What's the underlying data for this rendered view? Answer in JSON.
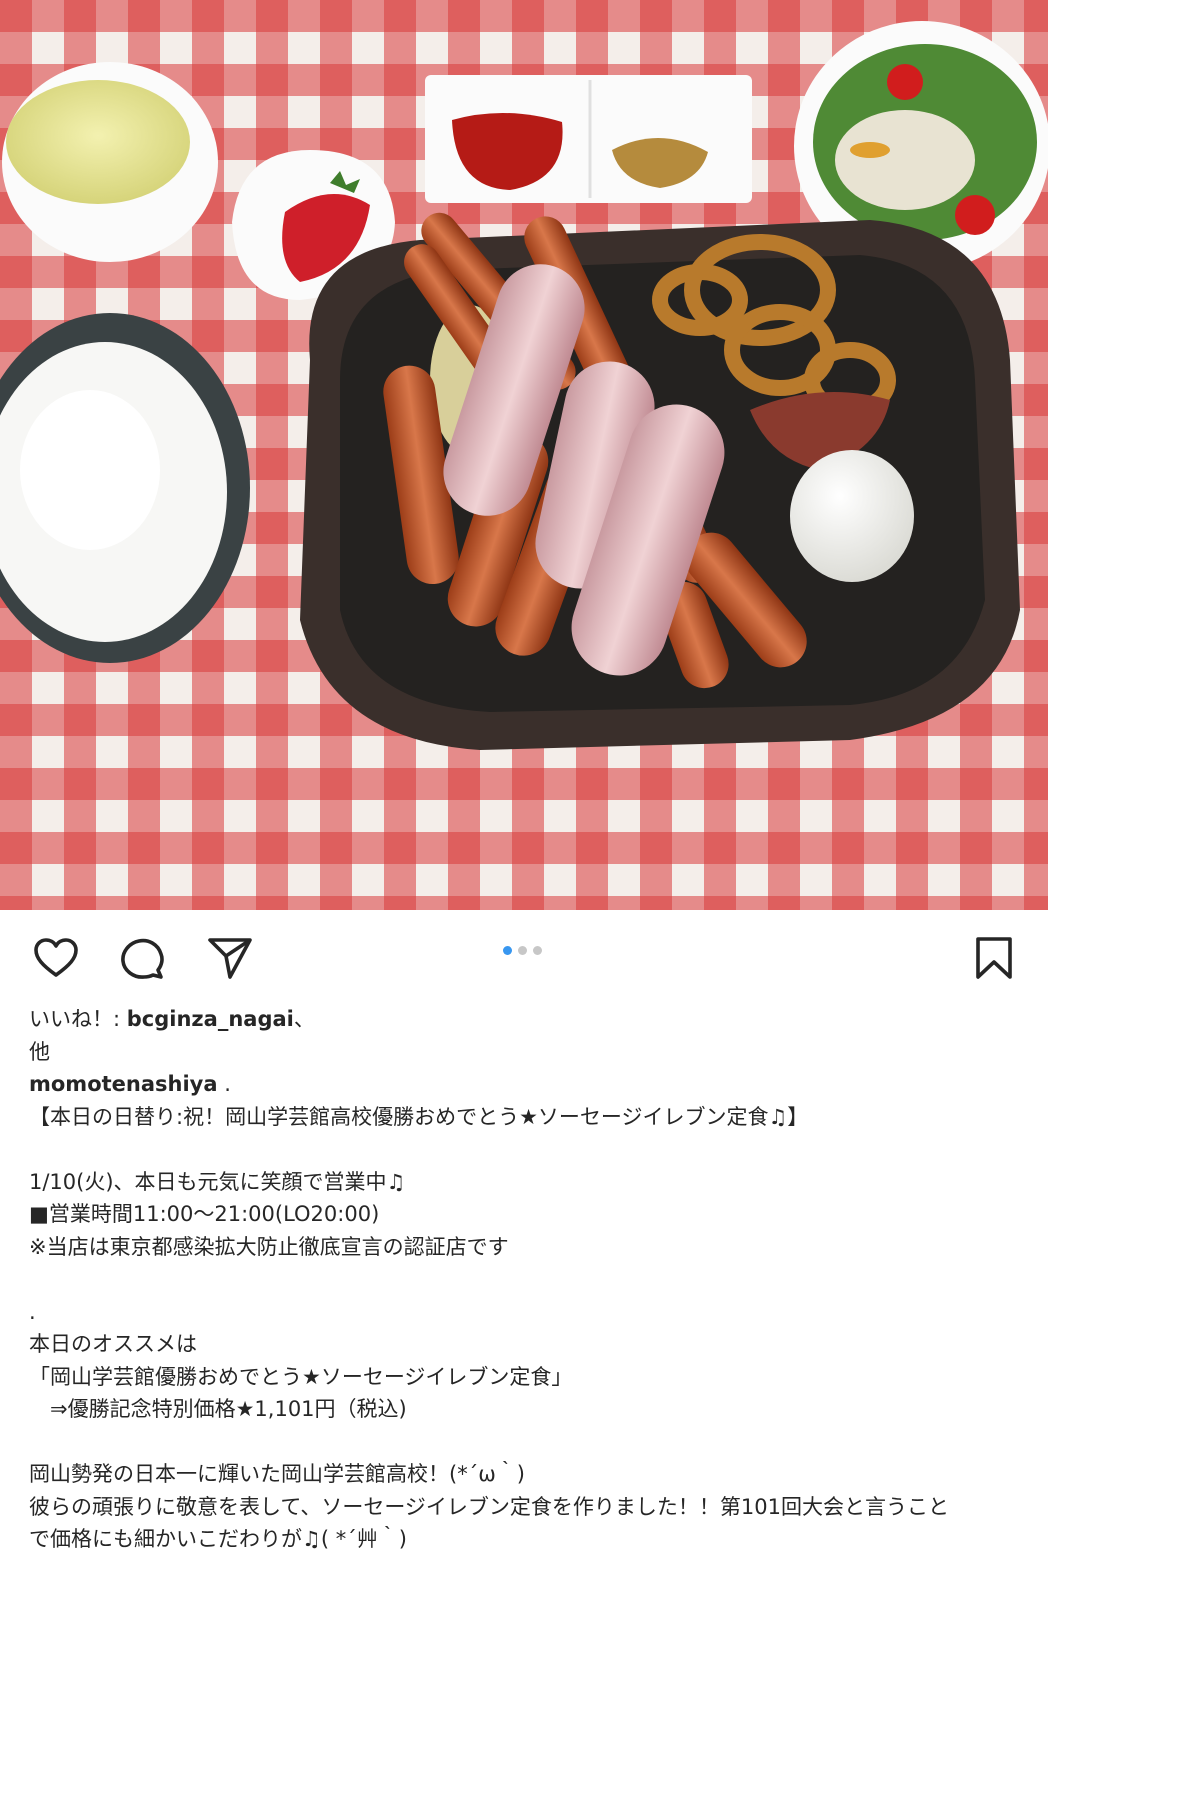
{
  "likes": {
    "prefix": "いいね！: ",
    "user": "bcginza_nagai",
    "suffix": "、",
    "others": "他"
  },
  "post": {
    "username": "momotenashiya",
    "username_suffix": " .",
    "caption_lines": [
      "【本日の日替り:祝！岡山学芸館高校優勝おめでとう★ソーセージイレブン定食♫】",
      "",
      "1/10(火)、本日も元気に笑顔で営業中♫",
      "■営業時間11:00〜21:00(LO20:00)",
      "※当店は東京都感染拡大防止徹底宣言の認証店です",
      "",
      ".",
      "本日のオススメは",
      "「岡山学芸館優勝おめでとう★ソーセージイレブン定食」",
      "　⇒優勝記念特別価格★1,101円（税込)",
      "",
      "岡山勢発の日本一に輝いた岡山学芸館高校！(*´ω｀)",
      "彼らの頑張りに敬意を表して、ソーセージイレブン定食を作りました！！第101回大会と言うこと",
      "で価格にも細かいこだわりが♫( *´艸｀)"
    ]
  },
  "carousel": {
    "count": 3,
    "active": 0
  },
  "icons": {
    "like": "heart-icon",
    "comment": "comment-bubble-icon",
    "share": "paper-plane-icon",
    "save": "bookmark-icon"
  },
  "colors": {
    "text": "#262626",
    "carousel_active": "#3897f0",
    "carousel_inactive": "#c7c7c7",
    "tablecloth_red": "#d83a3a"
  }
}
